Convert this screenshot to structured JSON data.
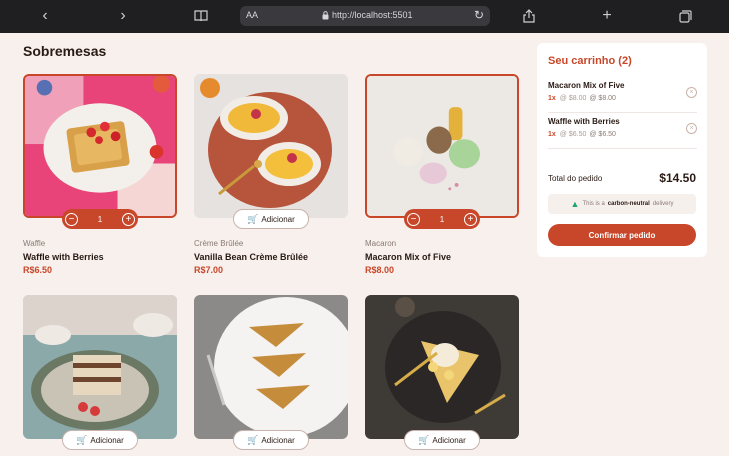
{
  "browser": {
    "text_size": "AA",
    "url": "http://localhost:5501"
  },
  "page": {
    "title": "Sobremesas"
  },
  "add_label": "Adicionar",
  "products": [
    {
      "category": "Waffle",
      "name": "Waffle with Berries",
      "price": "R$6.50",
      "qty": "1"
    },
    {
      "category": "Crème Brûlée",
      "name": "Vanilla Bean Crème Brûlée",
      "price": "R$7.00"
    },
    {
      "category": "Macaron",
      "name": "Macaron Mix of Five",
      "price": "R$8.00",
      "qty": "1"
    },
    {
      "category": "",
      "name": "",
      "price": ""
    },
    {
      "category": "",
      "name": "",
      "price": ""
    },
    {
      "category": "",
      "name": "",
      "price": ""
    }
  ],
  "cart": {
    "title": "Seu carrinho (2)",
    "items": [
      {
        "name": "Macaron Mix of Five",
        "qty": "1x",
        "unit": "@ $8.00",
        "total": "@ $8.00"
      },
      {
        "name": "Waffle with Berries",
        "qty": "1x",
        "unit": "@ $6.50",
        "total": "@ $6.50"
      }
    ],
    "total_label": "Total do pedido",
    "total_value": "$14.50",
    "carbon_prefix": "This is a",
    "carbon_bold": "carbon-neutral",
    "carbon_suffix": "delivery",
    "confirm_label": "Confirmar pedido"
  },
  "colors": {
    "accent": "#c8472a",
    "background": "#f7f0ec",
    "green": "#1ea575"
  }
}
